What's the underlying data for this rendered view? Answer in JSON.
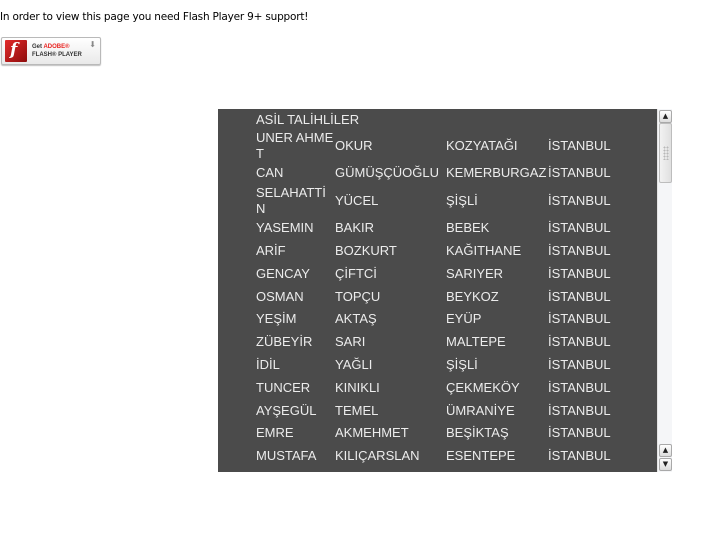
{
  "notice_text": "In order to view this page you need Flash Player 9+ support!",
  "flash_badge": {
    "logo_glyph": "f",
    "line1_prefix": "Get ",
    "line1_brand": "ADOBE®",
    "line2": "FLASH® PLAYER",
    "download_icon": "⬇",
    "brand_color": "#e8221f"
  },
  "list": {
    "title": "ASİL TALİHLİLER",
    "background": "#4b4b4b",
    "rows": [
      {
        "first": "UNER AHMET",
        "last": "OKUR",
        "district": "KOZYATAĞI",
        "city": "İSTANBUL"
      },
      {
        "first": "CAN",
        "last": "GÜMÜŞÇÜOĞLU",
        "district": "KEMERBURGAZ",
        "city": "İSTANBUL"
      },
      {
        "first": "SELAHATTİN",
        "last": "YÜCEL",
        "district": "ŞİŞLİ",
        "city": "İSTANBUL"
      },
      {
        "first": "YASEMIN",
        "last": "BAKIR",
        "district": "BEBEK",
        "city": "İSTANBUL"
      },
      {
        "first": "ARİF",
        "last": "BOZKURT",
        "district": "KAĞITHANE",
        "city": "İSTANBUL"
      },
      {
        "first": "GENCAY",
        "last": "ÇİFTCİ",
        "district": "SARIYER",
        "city": "İSTANBUL"
      },
      {
        "first": "OSMAN",
        "last": "TOPÇU",
        "district": "BEYKOZ",
        "city": "İSTANBUL"
      },
      {
        "first": "YEŞİM",
        "last": "AKTAŞ",
        "district": "EYÜP",
        "city": "İSTANBUL"
      },
      {
        "first": "ZÜBEYİR",
        "last": "SARI",
        "district": "MALTEPE",
        "city": "İSTANBUL"
      },
      {
        "first": "İDİL",
        "last": "YAĞLI",
        "district": "ŞİŞLİ",
        "city": "İSTANBUL"
      },
      {
        "first": "TUNCER",
        "last": "KINIKLI",
        "district": "ÇEKMEKÖY",
        "city": "İSTANBUL"
      },
      {
        "first": "AYŞEGÜL",
        "last": "TEMEL",
        "district": "ÜMRANİYE",
        "city": "İSTANBUL"
      },
      {
        "first": "EMRE",
        "last": "AKMEHMET",
        "district": "BEŞİKTAŞ",
        "city": "İSTANBUL"
      },
      {
        "first": "MUSTAFA",
        "last": "KILIÇARSLAN",
        "district": "ESENTEPE",
        "city": "İSTANBUL"
      }
    ]
  },
  "scrollbar": {
    "up_icon": "▲",
    "down_icon": "▼"
  }
}
